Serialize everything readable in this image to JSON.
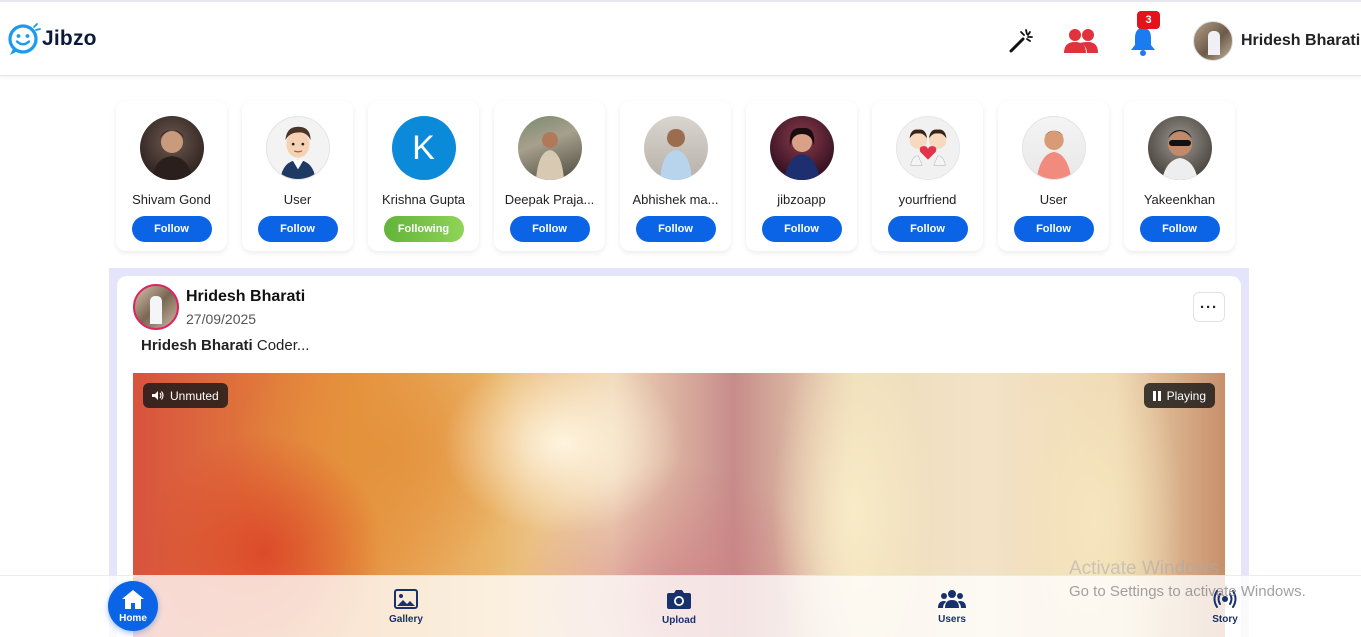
{
  "app": {
    "name": "Jibzo",
    "brand_color": "#0b63e5",
    "notification_count": "3",
    "user_name": "Hridesh Bharati"
  },
  "header_icons": [
    "magic-wand-icon",
    "friends-icon",
    "bell-icon"
  ],
  "suggestions": [
    {
      "name": "Shivam Gond",
      "button": "Follow",
      "following": false
    },
    {
      "name": "User",
      "button": "Follow",
      "following": false
    },
    {
      "name": "Krishna Gupta",
      "button": "Following",
      "following": true,
      "initial": "K"
    },
    {
      "name": "Deepak Praja...",
      "button": "Follow",
      "following": false
    },
    {
      "name": "Abhishek ma...",
      "button": "Follow",
      "following": false
    },
    {
      "name": "jibzoapp",
      "button": "Follow",
      "following": false
    },
    {
      "name": "yourfriend",
      "button": "Follow",
      "following": false
    },
    {
      "name": "User",
      "button": "Follow",
      "following": false
    },
    {
      "name": "Yakeenkhan",
      "button": "Follow",
      "following": false
    }
  ],
  "post": {
    "author": "Hridesh Bharati",
    "date": "27/09/2025",
    "caption_author": "Hridesh Bharati",
    "caption_text": "Coder...",
    "more": "···",
    "video": {
      "mute_label": "Unmuted",
      "play_label": "Playing"
    }
  },
  "watermark": {
    "line1": "Activate Windows",
    "line2": "Go to Settings to activate Windows."
  },
  "bottom_nav": {
    "home": "Home",
    "gallery": "Gallery",
    "upload": "Upload",
    "users": "Users",
    "story": "Story"
  }
}
